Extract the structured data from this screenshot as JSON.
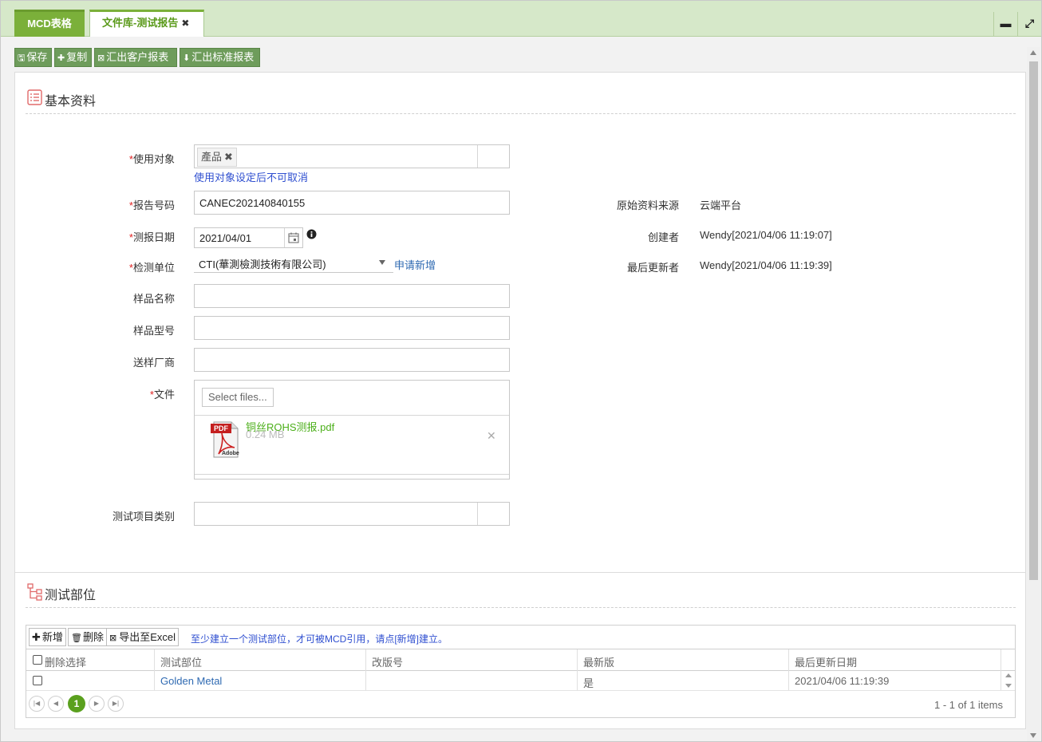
{
  "tabs": {
    "mcd": "MCD表格",
    "doc": "文件库-测试报告",
    "doc_close": "✖"
  },
  "window": {
    "minimize": "▬",
    "maximize": "⤢"
  },
  "toolbar": {
    "save": "保存",
    "copy": "复制",
    "export_customer": "汇出客户报表",
    "export_standard": "汇出标准报表",
    "save_icon": "🖫",
    "copy_icon": "✚",
    "export_customer_icon": "⊠",
    "export_standard_icon": "⬇"
  },
  "basic": {
    "title": "基本资料",
    "target_label": "使用对象",
    "target_tag": "產品",
    "target_tag_x": "✖",
    "target_hint": "使用对象设定后不可取消",
    "report_no_label": "报告号码",
    "report_no": "CANEC202140840155",
    "test_date_label": "测报日期",
    "test_date": "2021/04/01",
    "lab_label": "检测单位",
    "lab": "CTI(華測檢測技術有限公司)",
    "lab_apply": "申请新增",
    "sample_name_label": "样品名称",
    "sample_name": "",
    "sample_model_label": "样品型号",
    "sample_model": "",
    "vendor_label": "送样厂商",
    "vendor": "",
    "file_label": "文件",
    "select_files": "Select files...",
    "file_name": "铜丝ROHS测报.pdf",
    "file_size": "0.24 MB",
    "file_remove": "✕",
    "pdf_label": "PDF",
    "pdf_brand": "Adobe",
    "category_label": "测试项目类别",
    "required_mark": "*",
    "source_label": "原始资料来源",
    "source": "云端平台",
    "creator_label": "创建者",
    "creator": "Wendy[2021/04/06 11:19:07]",
    "updater_label": "最后更新者",
    "updater": "Wendy[2021/04/06 11:19:39]"
  },
  "parts": {
    "title": "测试部位",
    "add": "新增",
    "delete": "删除",
    "export": "导出至Excel",
    "hint": "至少建立一个测试部位，才可被MCD引用，请点[新增]建立。",
    "columns": [
      "删除选择",
      "测试部位",
      "改版号",
      "最新版",
      "最后更新日期"
    ],
    "rows": [
      {
        "part": "Golden Metal",
        "rev": "",
        "latest": "是",
        "updated": "2021/04/06 11:19:39"
      }
    ],
    "pager": {
      "current": "1",
      "info": "1 - 1 of 1 items"
    }
  }
}
